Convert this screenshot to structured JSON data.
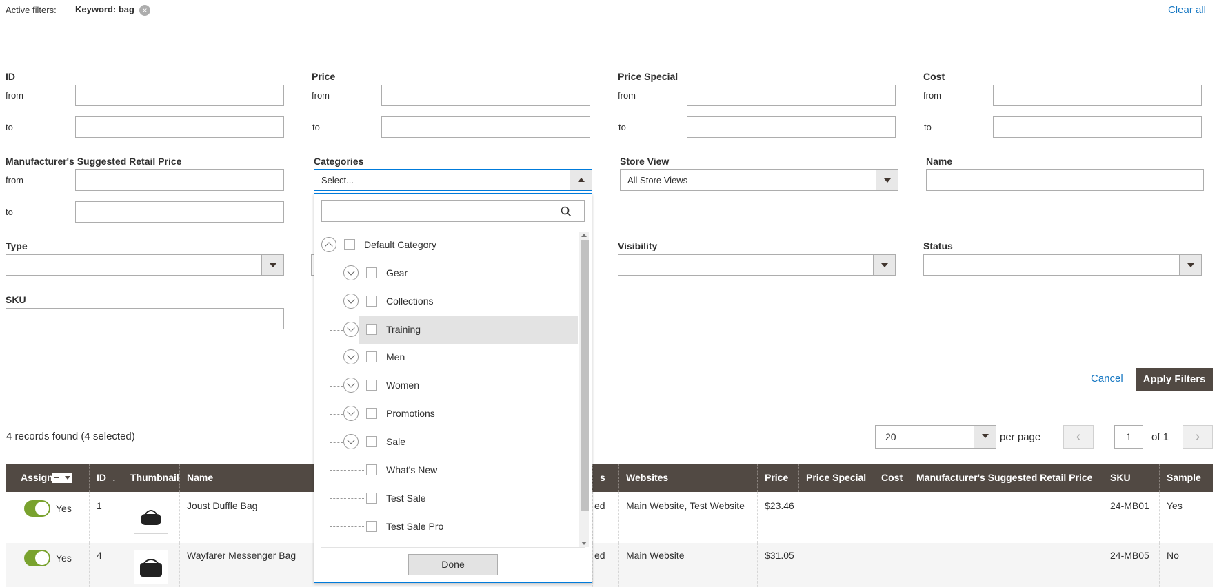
{
  "active_filters": {
    "label": "Active filters:",
    "chip": "Keyword: bag",
    "clear_all": "Clear all"
  },
  "filters": {
    "id": {
      "label": "ID",
      "from": "from",
      "to": "to"
    },
    "price": {
      "label": "Price",
      "from": "from",
      "to": "to"
    },
    "price_special": {
      "label": "Price Special",
      "from": "from",
      "to": "to"
    },
    "cost": {
      "label": "Cost",
      "from": "from",
      "to": "to"
    },
    "msrp": {
      "label": "Manufacturer's Suggested Retail Price",
      "from": "from",
      "to": "to"
    },
    "categories": {
      "label": "Categories",
      "placeholder": "Select..."
    },
    "store_view": {
      "label": "Store View",
      "value": "All Store Views"
    },
    "name": {
      "label": "Name"
    },
    "type": {
      "label": "Type",
      "value": ""
    },
    "visibility": {
      "label": "Visibility",
      "value": ""
    },
    "status": {
      "label": "Status",
      "value": ""
    },
    "sku": {
      "label": "SKU"
    },
    "cancel": "Cancel",
    "apply": "Apply Filters"
  },
  "category_tree": {
    "root": "Default Category",
    "items": [
      "Gear",
      "Collections",
      "Training",
      "Men",
      "Women",
      "Promotions",
      "Sale"
    ],
    "leaf_items": [
      "What's New",
      "Test Sale",
      "Test Sale Pro"
    ],
    "done": "Done"
  },
  "toolbar": {
    "records": "4 records found (4 selected)",
    "per_page_value": "20",
    "per_page_label": "per page",
    "page": "1",
    "of_pages": "of 1"
  },
  "grid": {
    "headers": {
      "assign": "Assign",
      "id": "ID",
      "thumbnail": "Thumbnail",
      "name": "Name",
      "status_partial": "s",
      "websites": "Websites",
      "price": "Price",
      "price_special": "Price Special",
      "cost": "Cost",
      "msrp": "Manufacturer's Suggested Retail Price",
      "sku": "SKU",
      "sample": "Sample"
    },
    "rows": [
      {
        "assign": "Yes",
        "id": "1",
        "name": "Joust Duffle Bag",
        "status": "ed",
        "websites": "Main Website, Test Website",
        "price": "$23.46",
        "sku": "24-MB01",
        "sample": "Yes"
      },
      {
        "assign": "Yes",
        "id": "4",
        "name": "Wayfarer Messenger Bag",
        "status": "ed",
        "websites": "Main Website",
        "price": "$31.05",
        "sku": "24-MB05",
        "sample": "No"
      }
    ]
  },
  "colors": {
    "link": "#1979c3",
    "header_bg": "#514943",
    "toggle_on": "#79a22e",
    "apply_bg": "#514943"
  }
}
